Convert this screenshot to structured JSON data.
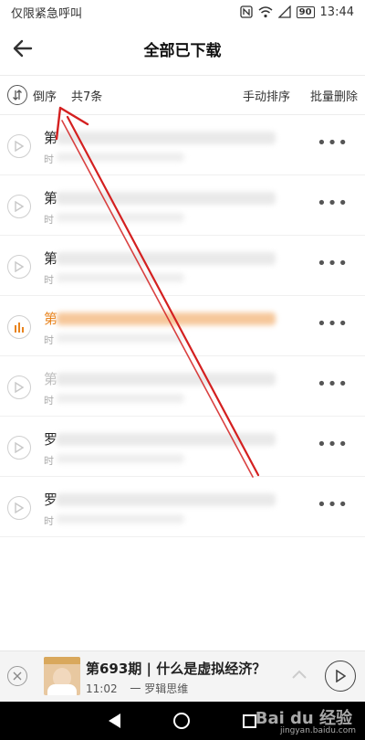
{
  "status_bar": {
    "left_text": "仅限紧急呼叫",
    "battery": "90",
    "time": "13:44"
  },
  "header": {
    "title": "全部已下载",
    "back_icon": "arrow-left-icon"
  },
  "toolbar": {
    "sort_label": "倒序",
    "total_label": "共7条",
    "manual_sort_label": "手动排序",
    "batch_delete_label": "批量删除"
  },
  "list": {
    "items": [
      {
        "title_prefix": "第",
        "sub_prefix": "时",
        "state": "normal"
      },
      {
        "title_prefix": "第",
        "sub_prefix": "时",
        "state": "normal"
      },
      {
        "title_prefix": "第",
        "sub_prefix": "时",
        "state": "normal"
      },
      {
        "title_prefix": "第",
        "sub_prefix": "时",
        "state": "playing"
      },
      {
        "title_prefix": "第",
        "sub_prefix": "时",
        "state": "faded"
      },
      {
        "title_prefix": "罗",
        "sub_prefix": "时",
        "state": "normal"
      },
      {
        "title_prefix": "罗",
        "sub_prefix": "时",
        "state": "normal"
      }
    ],
    "more_label": "•••"
  },
  "player": {
    "title": "第693期 | 什么是虚拟经济？",
    "time": "11:02",
    "author": "一 罗辑思维"
  },
  "watermark": {
    "brand": "Bai du 经验",
    "url": "jingyan.baidu.com"
  },
  "colors": {
    "accent": "#e8831c",
    "annotation_arrow": "#d42020"
  }
}
